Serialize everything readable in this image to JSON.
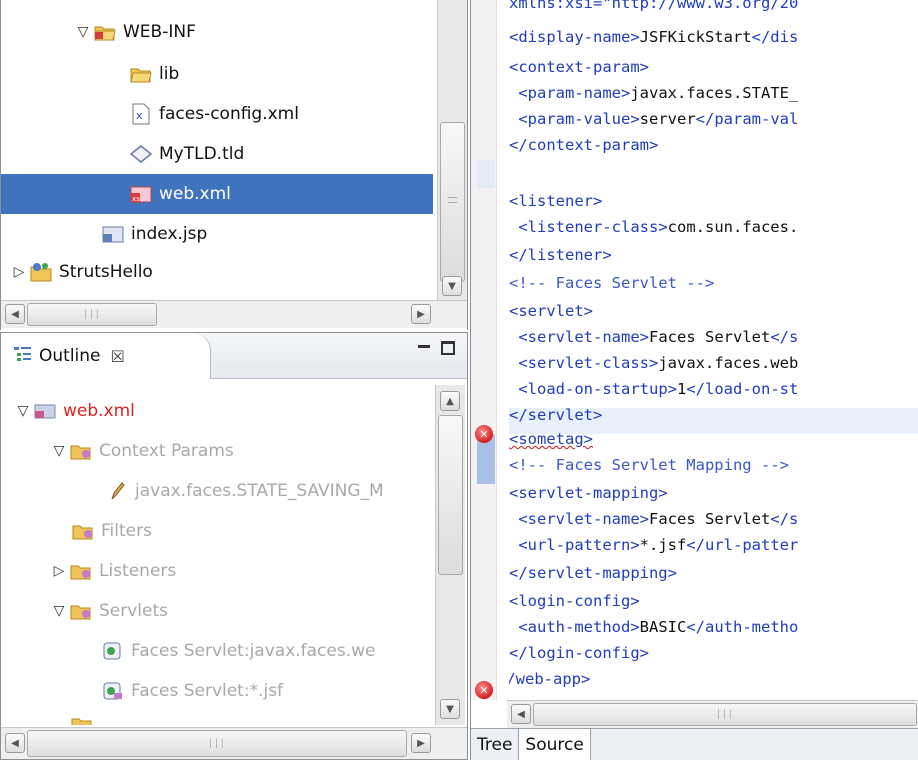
{
  "project_explorer": {
    "items": [
      {
        "label": "WEB-INF",
        "icon": "folder-web-icon",
        "twisty": "expanded"
      },
      {
        "label": "lib",
        "icon": "folder-icon"
      },
      {
        "label": "faces-config.xml",
        "icon": "xml-file-icon"
      },
      {
        "label": "MyTLD.tld",
        "icon": "tld-file-icon"
      },
      {
        "label": "web.xml",
        "icon": "webxml-file-icon",
        "selected": true
      },
      {
        "label": "index.jsp",
        "icon": "jsp-file-icon"
      },
      {
        "label": "StrutsHello",
        "icon": "project-icon",
        "twisty": "collapsed"
      }
    ]
  },
  "outline": {
    "tab_label": "Outline",
    "tab_close": "☒",
    "items": [
      {
        "label": "web.xml",
        "icon": "webxml-file-icon",
        "twisty": "expanded",
        "color": "#e02020"
      },
      {
        "label": "Context Params",
        "icon": "params-folder-icon",
        "twisty": "expanded"
      },
      {
        "label": "javax.faces.STATE_SAVING_M",
        "icon": "pencil-icon"
      },
      {
        "label": "Filters",
        "icon": "params-folder-icon"
      },
      {
        "label": "Listeners",
        "icon": "params-folder-icon",
        "twisty": "collapsed"
      },
      {
        "label": "Servlets",
        "icon": "params-folder-icon",
        "twisty": "expanded"
      },
      {
        "label": "Faces Servlet:javax.faces.we",
        "icon": "servlet-icon"
      },
      {
        "label": "Faces Servlet:*.jsf",
        "icon": "servlet-mapping-icon"
      }
    ]
  },
  "editor": {
    "lines": [
      "xmlns:xsi=\"http://www.w3.org/20",
      "<display-name>JSFKickStart</dis",
      "<context-param>",
      " <param-name>javax.faces.STATE_",
      " <param-value>server</param-val",
      "</context-param>",
      "",
      "<listener>",
      " <listener-class>com.sun.faces.",
      "</listener>",
      "<!-- Faces Servlet -->",
      "<servlet>",
      " <servlet-name>Faces Servlet</s",
      " <servlet-class>javax.faces.web",
      " <load-on-startup>1</load-on-st",
      "</servlet>",
      "<sometag>",
      "<!-- Faces Servlet Mapping -->",
      "<servlet-mapping>",
      " <servlet-name>Faces Servlet</s",
      " <url-pattern>*.jsf</url-patter",
      "</servlet-mapping>",
      "<login-config>",
      " <auth-method>BASIC</auth-metho",
      "</login-config>",
      "</web-app>"
    ],
    "error_marker": "✕",
    "tabs": [
      {
        "label": "Tree",
        "active": false
      },
      {
        "label": "Source",
        "active": true
      }
    ]
  },
  "colors": {
    "selection": "#3f73bd",
    "tag": "#1f3bbf",
    "error": "#d41f1f"
  }
}
